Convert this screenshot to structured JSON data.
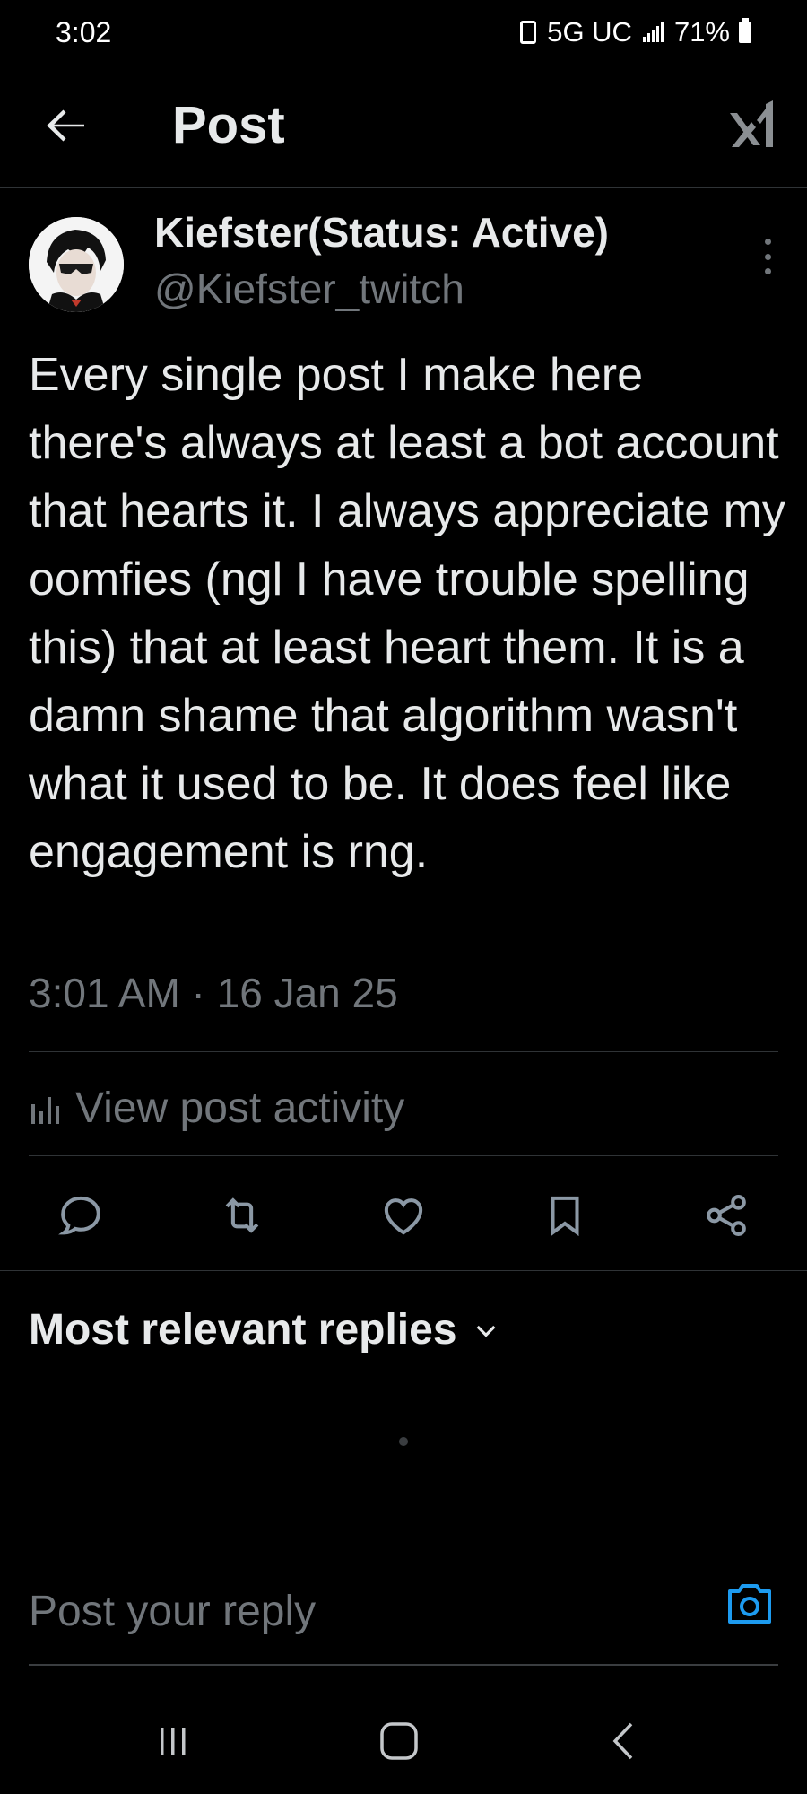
{
  "status_bar": {
    "time": "3:02",
    "network": "5G UC",
    "battery": "71%"
  },
  "header": {
    "title": "Post",
    "back_icon": "arrow-left-icon",
    "grok_icon": "grok-icon"
  },
  "post": {
    "author_name": "Kiefster(Status: Active)",
    "author_handle": "@Kiefster_twitch",
    "text": "Every single post I make here there's always at least a bot account that hearts it. I always appreciate my oomfies (ngl I have trouble spelling this) that at least heart them. It is a damn shame that algorithm wasn't what it used to be. It does feel like engagement is rng.",
    "timestamp": "3:01 AM · 16 Jan 25"
  },
  "activity": {
    "label": "View post activity",
    "icon": "bar-chart-icon"
  },
  "actions": [
    {
      "name": "reply",
      "icon": "reply-icon"
    },
    {
      "name": "repost",
      "icon": "repost-icon"
    },
    {
      "name": "like",
      "icon": "heart-icon"
    },
    {
      "name": "bookmark",
      "icon": "bookmark-icon"
    },
    {
      "name": "share",
      "icon": "share-icon"
    }
  ],
  "replies": {
    "sort_label": "Most relevant replies"
  },
  "reply_box": {
    "placeholder": "Post your reply",
    "icon": "camera-icon"
  },
  "colors": {
    "background": "#000000",
    "text_primary": "#e7e9ea",
    "text_secondary": "#71767b",
    "divider": "#2f3336",
    "accent": "#1d9bf0"
  }
}
